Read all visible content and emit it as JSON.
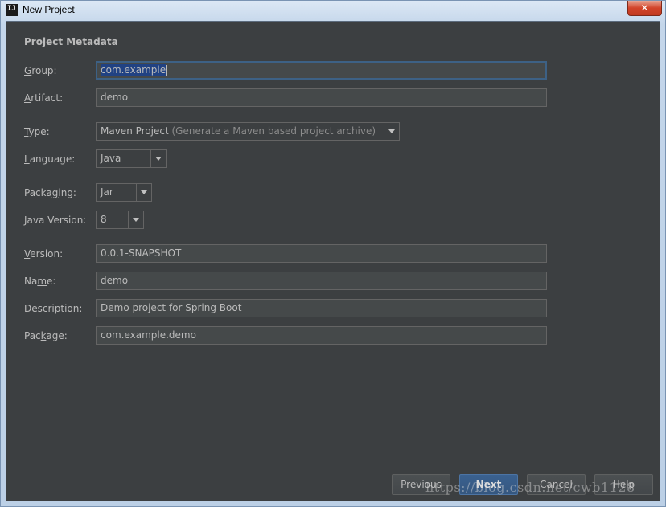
{
  "window": {
    "title": "New Project",
    "app_icon_text": "IJ",
    "close_symbol": "✕"
  },
  "form": {
    "section_title": "Project Metadata",
    "group": {
      "label_mnemonic": "G",
      "label_rest": "roup:",
      "value": "com.example"
    },
    "artifact": {
      "label_mnemonic": "A",
      "label_rest": "rtifact:",
      "value": "demo"
    },
    "type": {
      "label_mnemonic": "T",
      "label_rest": "ype:",
      "value": "Maven Project",
      "hint": "(Generate a Maven based project archive)"
    },
    "language": {
      "label_mnemonic": "L",
      "label_rest": "anguage:",
      "value": "Java"
    },
    "packaging": {
      "label_pre": "Packa",
      "label_mnemonic": "g",
      "label_rest": "ing:",
      "value": "Jar"
    },
    "java_version": {
      "label_mnemonic": "J",
      "label_rest": "ava Version:",
      "value": "8"
    },
    "version": {
      "label_mnemonic": "V",
      "label_rest": "ersion:",
      "value": "0.0.1-SNAPSHOT"
    },
    "name": {
      "label_pre": "Na",
      "label_mnemonic": "m",
      "label_rest": "e:",
      "value": "demo"
    },
    "description": {
      "label_mnemonic": "D",
      "label_rest": "escription:",
      "value": "Demo project for Spring Boot"
    },
    "package": {
      "label_pre": "Pac",
      "label_mnemonic": "k",
      "label_rest": "age:",
      "value": "com.example.demo"
    }
  },
  "buttons": {
    "previous": {
      "mnemonic": "P",
      "rest": "revious"
    },
    "next": {
      "mnemonic": "N",
      "rest": "ext"
    },
    "cancel": {
      "label": "Cancel"
    },
    "help": {
      "label": "Help"
    }
  },
  "watermark": "https://blog.csdn.net/cwb1128",
  "colors": {
    "panel_bg": "#3c3f41",
    "field_bg": "#45494a",
    "focus_border": "#3d6185",
    "selection": "#214283",
    "default_button": "#365880",
    "text": "#bbbbbb"
  }
}
